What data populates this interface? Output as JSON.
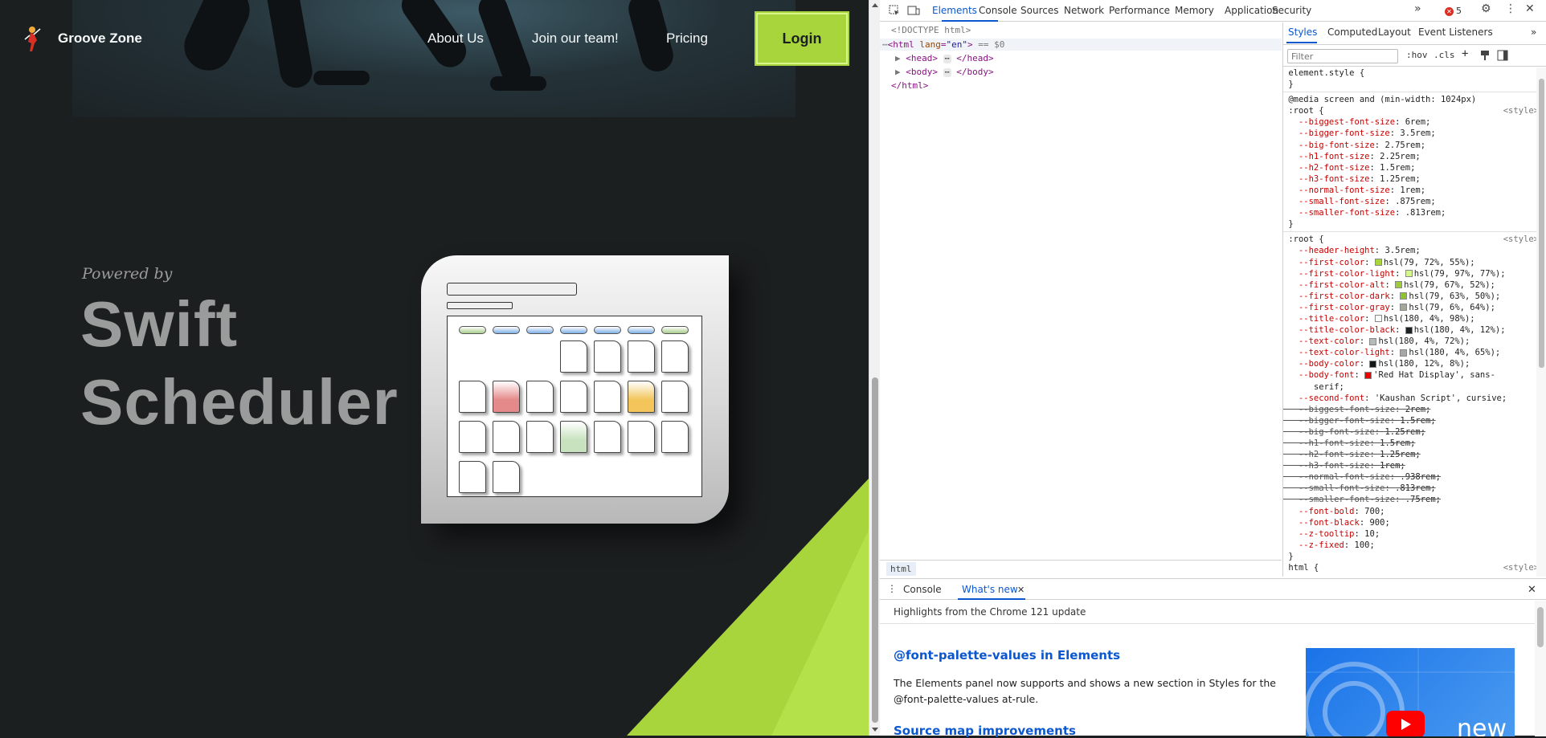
{
  "site": {
    "brand": "Groove Zone",
    "nav": [
      "About Us",
      "Join our team!",
      "Pricing"
    ],
    "login_label": "Login",
    "powered_by": "Powered by",
    "title_line1": "Swift",
    "title_line2": "Scheduler",
    "accent_color": "#a8d53c",
    "background_color": "#1c1f20"
  },
  "devtools": {
    "tabs": [
      "Elements",
      "Console",
      "Sources",
      "Network",
      "Performance",
      "Memory",
      "Application",
      "Security"
    ],
    "active_tab": "Elements",
    "more_tabs": "»",
    "error_count": "5",
    "icons": [
      "inspect-icon",
      "device-toggle-icon",
      "settings-icon",
      "more-icon",
      "close-icon"
    ],
    "dom": {
      "doctype": "<!DOCTYPE html>",
      "html_open_tag": "html",
      "html_attr": "lang",
      "html_attr_value": "\"en\"",
      "html_suffix": " == $0",
      "head_tag": "head",
      "body_tag": "body",
      "html_close": "</html>",
      "ellipsis": "⋯"
    },
    "breadcrumb": "html",
    "styles_tabs": [
      "Styles",
      "Computed",
      "Layout",
      "Event Listeners"
    ],
    "styles_more": "»",
    "filter_placeholder": "Filter",
    "filter_tools": [
      ":hov",
      ".cls",
      "+"
    ],
    "element_style_selector": "element.style {",
    "close_brace": "}",
    "media_query": "@media screen and (min-width: 1024px)",
    "root_selector": ":root {",
    "style_source": "<style>",
    "root_rule1": [
      {
        "prop": "--biggest-font-size",
        "val": "6rem;"
      },
      {
        "prop": "--bigger-font-size",
        "val": "3.5rem;"
      },
      {
        "prop": "--big-font-size",
        "val": "2.75rem;"
      },
      {
        "prop": "--h1-font-size",
        "val": "2.25rem;"
      },
      {
        "prop": "--h2-font-size",
        "val": "1.5rem;"
      },
      {
        "prop": "--h3-font-size",
        "val": "1.25rem;"
      },
      {
        "prop": "--normal-font-size",
        "val": "1rem;"
      },
      {
        "prop": "--small-font-size",
        "val": ".875rem;"
      },
      {
        "prop": "--smaller-font-size",
        "val": ".813rem;"
      }
    ],
    "root_rule2": [
      {
        "prop": "--header-height",
        "val": "3.5rem;"
      },
      {
        "prop": "--first-color",
        "val": "hsl(79, 72%, 55%);",
        "swatch": "#a8d53c"
      },
      {
        "prop": "--first-color-light",
        "val": "hsl(79, 97%, 77%);",
        "swatch": "#d6f58a"
      },
      {
        "prop": "--first-color-alt",
        "val": "hsl(79, 67%, 52%);",
        "swatch": "#9dcc33"
      },
      {
        "prop": "--first-color-dark",
        "val": "hsl(79, 63%, 50%);",
        "swatch": "#8fc22f"
      },
      {
        "prop": "--first-color-gray",
        "val": "hsl(79, 6%, 64%);",
        "swatch": "#a4a898"
      },
      {
        "prop": "--title-color",
        "val": "hsl(180, 4%, 98%);",
        "swatch": "#f9fafa"
      },
      {
        "prop": "--title-color-black",
        "val": "hsl(180, 4%, 12%);",
        "swatch": "#1d2020"
      },
      {
        "prop": "--text-color",
        "val": "hsl(180, 4%, 72%);",
        "swatch": "#b5baba"
      },
      {
        "prop": "--text-color-light",
        "val": "hsl(180, 4%, 65%);",
        "swatch": "#a4a8a8"
      },
      {
        "prop": "--body-color",
        "val": "hsl(180, 12%, 8%);",
        "swatch": "#121717"
      },
      {
        "prop": "--body-font",
        "val": "'",
        "swatch": "#ee0000",
        "val_tail": "Red Hat Display', sans-",
        "wrap": "serif;"
      },
      {
        "prop": "--second-font",
        "val": "'Kaushan Script', cursive;"
      },
      {
        "prop": "--biggest-font-size",
        "val": "2rem;",
        "strike": true
      },
      {
        "prop": "--bigger-font-size",
        "val": "1.5rem;",
        "strike": true
      },
      {
        "prop": "--big-font-size",
        "val": "1.25rem;",
        "strike": true
      },
      {
        "prop": "--h1-font-size",
        "val": "1.5rem;",
        "strike": true
      },
      {
        "prop": "--h2-font-size",
        "val": "1.25rem;",
        "strike": true
      },
      {
        "prop": "--h3-font-size",
        "val": "1rem;",
        "strike": true
      },
      {
        "prop": "--normal-font-size",
        "val": ".938rem;",
        "strike": true
      },
      {
        "prop": "--small-font-size",
        "val": ".813rem;",
        "strike": true
      },
      {
        "prop": "--smaller-font-size",
        "val": ".75rem;",
        "strike": true
      },
      {
        "prop": "--font-bold",
        "val": "700;"
      },
      {
        "prop": "--font-black",
        "val": "900;"
      },
      {
        "prop": "--z-tooltip",
        "val": "10;"
      },
      {
        "prop": "--z-fixed",
        "val": "100;"
      }
    ],
    "partial_next": "html {",
    "drawer": {
      "tabs": [
        "Console",
        "What's new"
      ],
      "active_tab": "What's new",
      "highlights": "Highlights from the Chrome 121 update",
      "heading1": "@font-palette-values in Elements",
      "body1": "The Elements panel now supports and shows a new section in Styles for the @font-palette-values at-rule.",
      "heading2": "Source map improvements",
      "image_caption": "new"
    }
  }
}
